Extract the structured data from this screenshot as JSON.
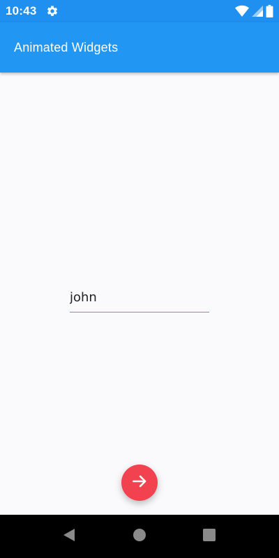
{
  "status_bar": {
    "time": "10:43",
    "icons": [
      "settings-icon",
      "wifi-icon",
      "signal-icon",
      "battery-icon"
    ]
  },
  "app_bar": {
    "title": "Animated Widgets",
    "color": "#2196f3"
  },
  "form": {
    "name_value": "john",
    "underline_color": "#2bb3c8"
  },
  "fab": {
    "icon": "arrow-forward-icon",
    "color": "#f2414f"
  },
  "nav_bar": {
    "buttons": [
      "back-icon",
      "home-icon",
      "recents-icon"
    ]
  }
}
